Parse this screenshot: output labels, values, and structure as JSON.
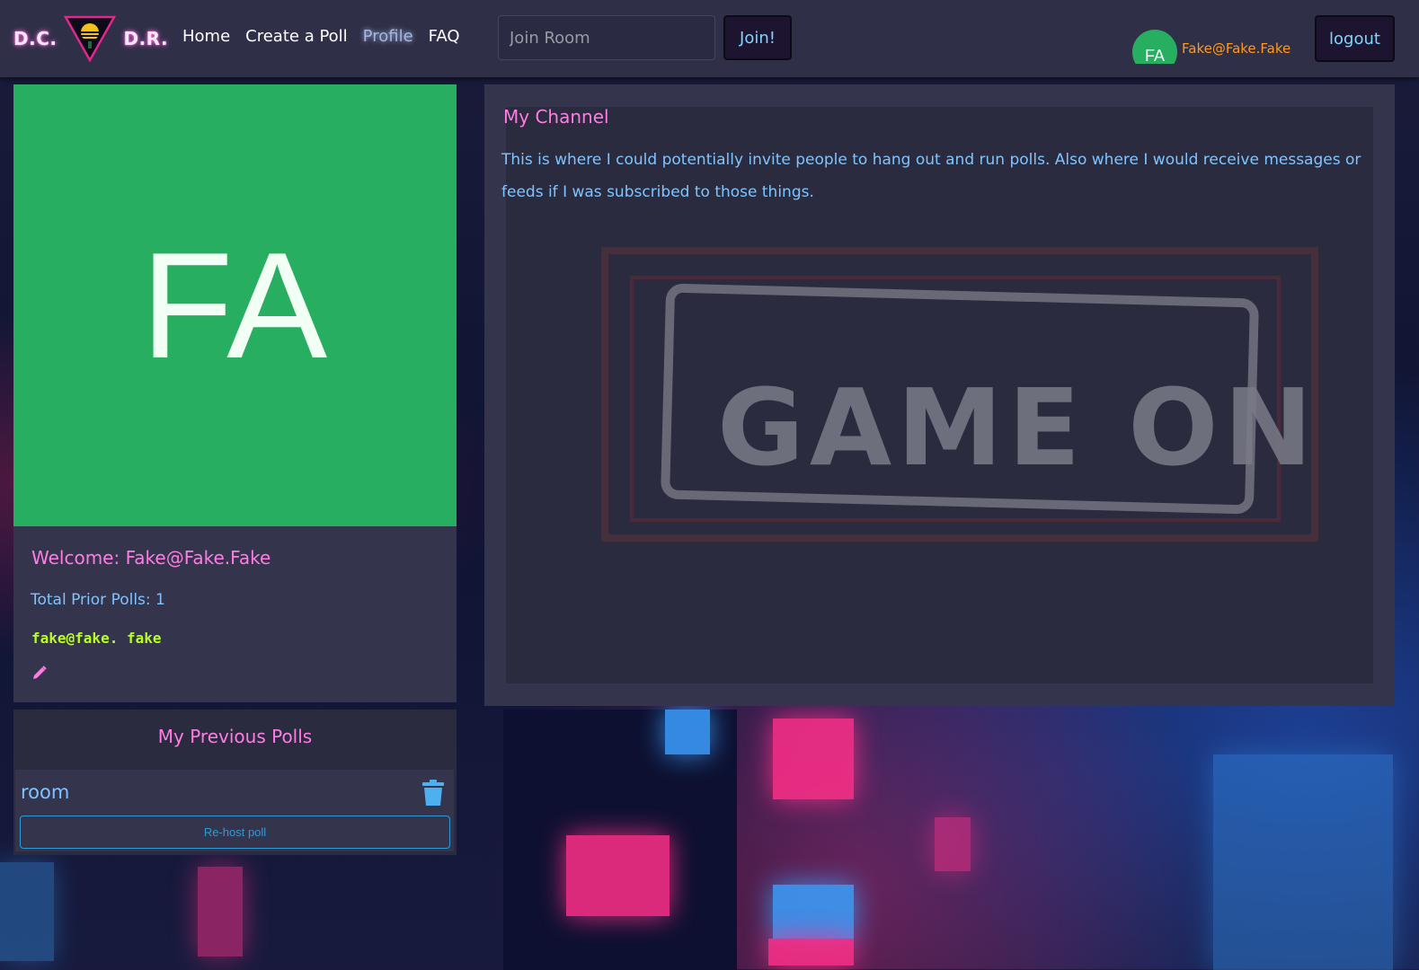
{
  "brand": {
    "left_text": "D.C.",
    "right_text": "D.R."
  },
  "nav": {
    "items": [
      {
        "label": "Home",
        "active": false
      },
      {
        "label": "Create a Poll",
        "active": false
      },
      {
        "label": "Profile",
        "active": true
      },
      {
        "label": "FAQ",
        "active": false
      }
    ]
  },
  "join": {
    "placeholder": "Join Room",
    "value": "",
    "button_label": "Join!"
  },
  "user": {
    "avatar_initials": "FA",
    "email": "Fake@Fake.Fake",
    "logout_label": "logout"
  },
  "profile": {
    "initials": "FA",
    "welcome_label": "Welcome: ",
    "welcome_name": "Fake@Fake.Fake",
    "total_polls_text": "Total Prior Polls: 1",
    "email": "fake@fake. fake"
  },
  "previous_polls": {
    "title": "My Previous Polls",
    "items": [
      {
        "name": "room",
        "rehost_label": "Re-host poll"
      }
    ]
  },
  "channel": {
    "title": "My Channel",
    "description": "This is where I could potentially invite people to hang out and run polls. Also where I would receive messages or feeds if I was subscribed to those things.",
    "image_text": "GAME ON"
  },
  "colors": {
    "nav_bg": "#2f3048",
    "card_bg": "#34344c",
    "avatar_green": "#27ae60",
    "pink_accent": "#ff7de3",
    "blue_text": "#7fc4ff",
    "lime_text": "#b7ff1f",
    "orange_email": "#ff9a1f"
  }
}
